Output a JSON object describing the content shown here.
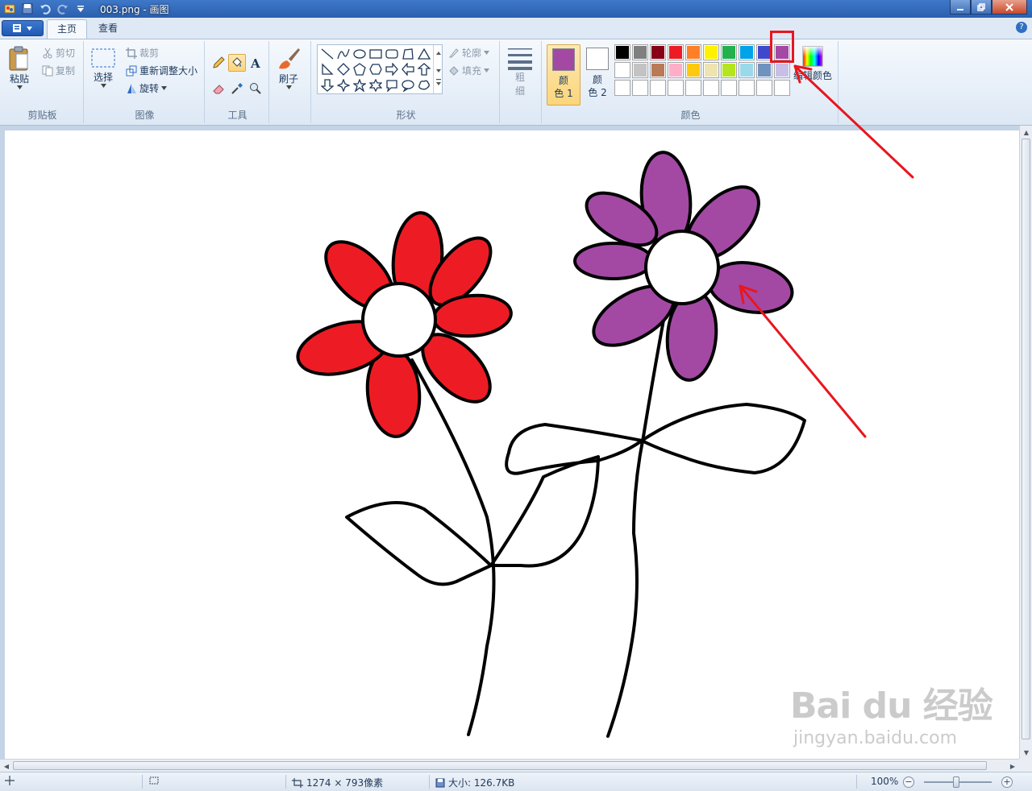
{
  "window": {
    "title": "003.png - 画图"
  },
  "tabs": [
    {
      "label": "主页",
      "active": true
    },
    {
      "label": "查看",
      "active": false
    }
  ],
  "ribbon": {
    "clipboard": {
      "group_label": "剪贴板",
      "paste": "粘贴",
      "cut": "剪切",
      "copy": "复制"
    },
    "image": {
      "group_label": "图像",
      "select": "选择",
      "crop": "裁剪",
      "resize": "重新调整大小",
      "rotate": "旋转"
    },
    "tools": {
      "group_label": "工具"
    },
    "brushes": {
      "label": "刷子"
    },
    "shapes": {
      "group_label": "形状",
      "outline": "轮廓",
      "fill": "填充"
    },
    "size": {
      "label_line1": "粗",
      "label_line2": "细"
    },
    "colors": {
      "group_label": "颜色",
      "color1_line1": "颜",
      "color1_line2": "色 1",
      "color2_line1": "颜",
      "color2_line2": "色 2",
      "edit_colors": "编辑颜色",
      "color1_value": "#a349a4",
      "color2_value": "#ffffff",
      "palette_row1": [
        "#000000",
        "#7f7f7f",
        "#880015",
        "#ed1c24",
        "#ff7f27",
        "#fff200",
        "#22b14c",
        "#00a2e8",
        "#3f48cc",
        "#a349a4"
      ],
      "palette_row2": [
        "#ffffff",
        "#c3c3c3",
        "#b97a57",
        "#ffaec9",
        "#ffc90e",
        "#efe4b0",
        "#b5e61d",
        "#99d9ea",
        "#7092be",
        "#c8bfe7"
      ],
      "palette_row3_empty": 10
    }
  },
  "canvas_colors": {
    "red_flower": "#ed1c24",
    "purple_flower": "#a349a4",
    "outline": "#000000"
  },
  "statusbar": {
    "dimensions": "1274 × 793像素",
    "size": "大小: 126.7KB",
    "zoom": "100%"
  },
  "watermark": {
    "logo": "Bai du 经验",
    "url": "jingyan.baidu.com"
  }
}
